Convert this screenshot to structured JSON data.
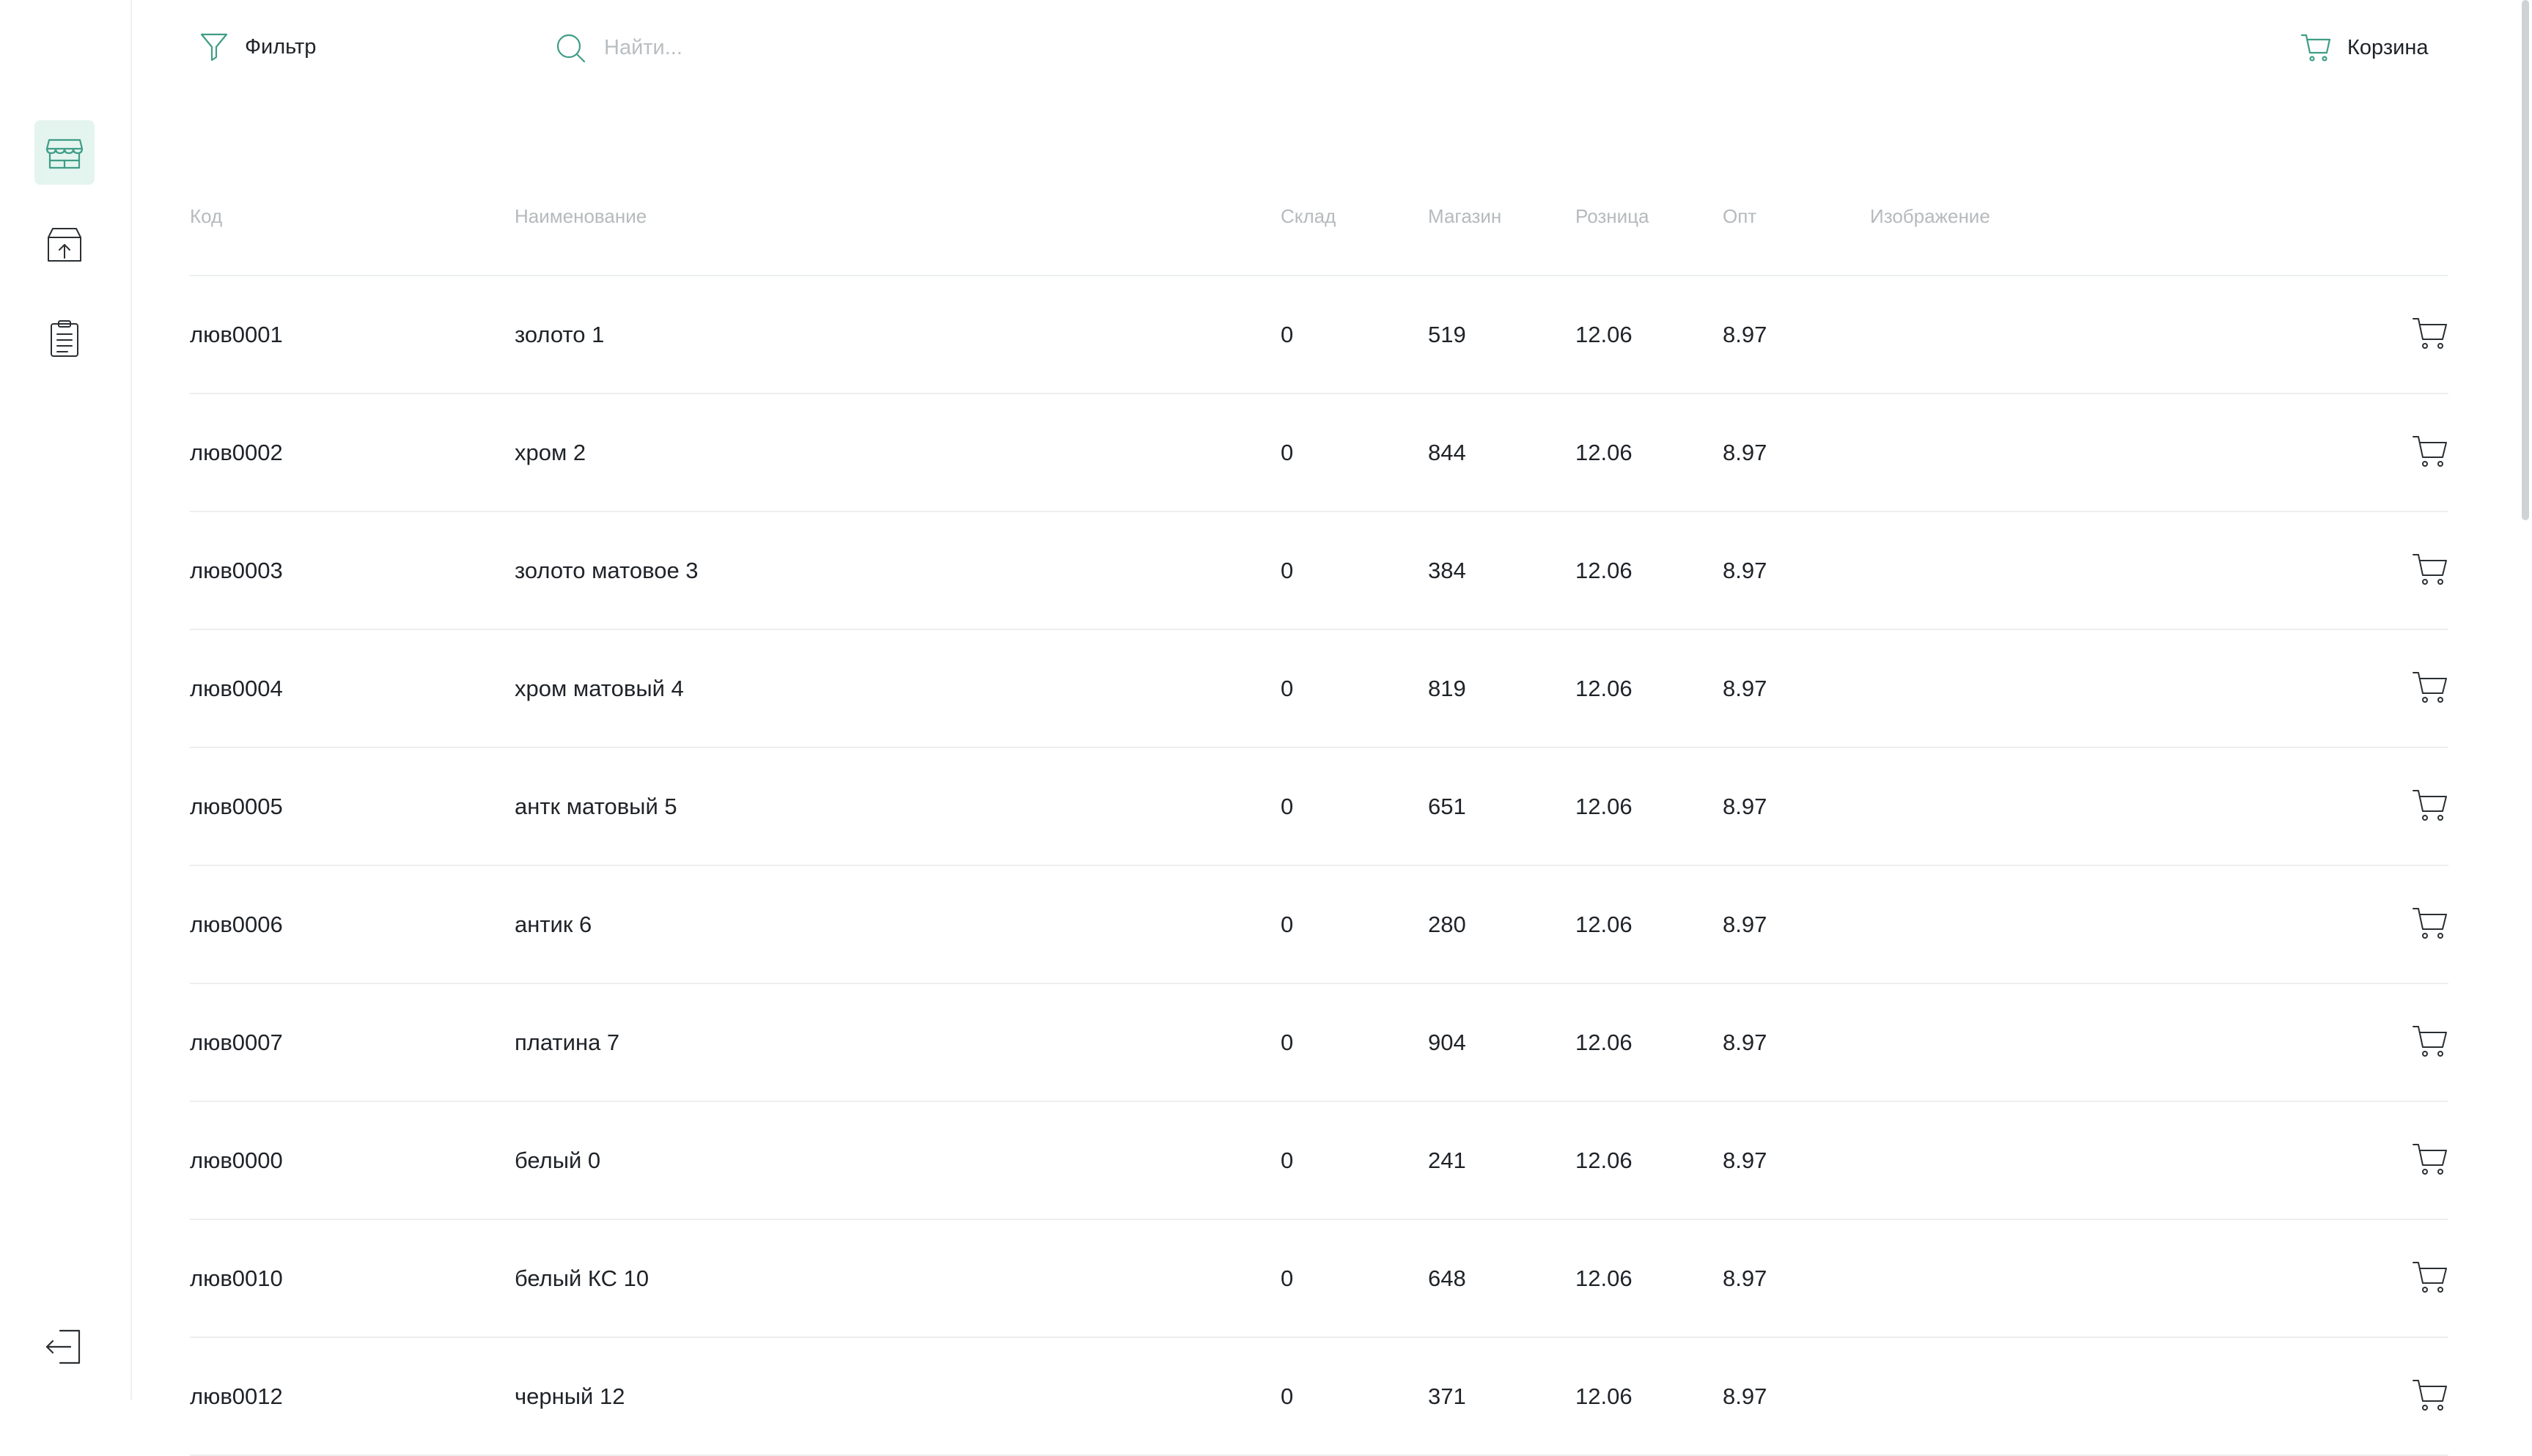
{
  "sidebar": {
    "items": [
      {
        "icon": "store-icon",
        "active": true
      },
      {
        "icon": "box-upload-icon",
        "active": false
      },
      {
        "icon": "clipboard-icon",
        "active": false
      }
    ],
    "logout_icon": "logout-icon"
  },
  "toolbar": {
    "filter_label": "Фильтр",
    "search_placeholder": "Найти...",
    "cart_label": "Корзина"
  },
  "colors": {
    "accent": "#3f9d86",
    "active_bg": "#e4f4ef",
    "header_text": "#b5babd",
    "divider": "#eceeef"
  },
  "table": {
    "headers": {
      "code": "Код",
      "name": "Наименование",
      "warehouse": "Склад",
      "store": "Магазин",
      "retail": "Розница",
      "wholesale": "Опт",
      "image": "Изображение"
    },
    "rows": [
      {
        "code": "люв0001",
        "name": "золото 1",
        "warehouse": "0",
        "store": "519",
        "retail": "12.06",
        "wholesale": "8.97"
      },
      {
        "code": "люв0002",
        "name": "хром 2",
        "warehouse": "0",
        "store": "844",
        "retail": "12.06",
        "wholesale": "8.97"
      },
      {
        "code": "люв0003",
        "name": "золото матовое 3",
        "warehouse": "0",
        "store": "384",
        "retail": "12.06",
        "wholesale": "8.97"
      },
      {
        "code": "люв0004",
        "name": "хром матовый 4",
        "warehouse": "0",
        "store": "819",
        "retail": "12.06",
        "wholesale": "8.97"
      },
      {
        "code": "люв0005",
        "name": "антк матовый 5",
        "warehouse": "0",
        "store": "651",
        "retail": "12.06",
        "wholesale": "8.97"
      },
      {
        "code": "люв0006",
        "name": "антик 6",
        "warehouse": "0",
        "store": "280",
        "retail": "12.06",
        "wholesale": "8.97"
      },
      {
        "code": "люв0007",
        "name": "платина 7",
        "warehouse": "0",
        "store": "904",
        "retail": "12.06",
        "wholesale": "8.97"
      },
      {
        "code": "люв0000",
        "name": "белый 0",
        "warehouse": "0",
        "store": "241",
        "retail": "12.06",
        "wholesale": "8.97"
      },
      {
        "code": "люв0010",
        "name": "белый КС 10",
        "warehouse": "0",
        "store": "648",
        "retail": "12.06",
        "wholesale": "8.97"
      },
      {
        "code": "люв0012",
        "name": "черный 12",
        "warehouse": "0",
        "store": "371",
        "retail": "12.06",
        "wholesale": "8.97"
      }
    ]
  }
}
